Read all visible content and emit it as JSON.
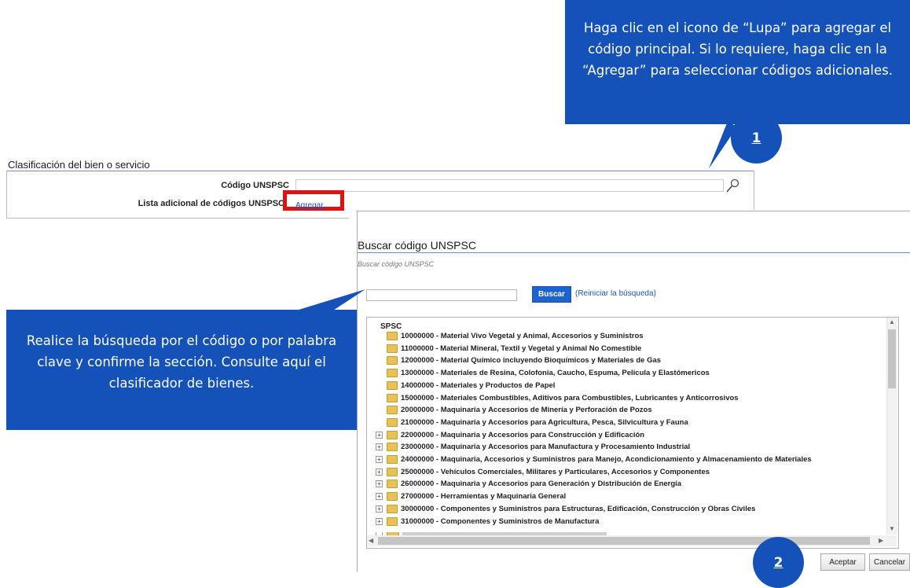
{
  "callout_1": {
    "text": "Haga clic en el icono de “Lupa” para agregar el código principal. Si lo requiere, haga clic en la “Agregar” para seleccionar códigos adicionales.",
    "step": "1"
  },
  "callout_2": {
    "text": "Realice la búsqueda por el código o por palabra clave y confirme la sección. Consulte aquí el clasificador de bienes."
  },
  "step_2": "2",
  "classification": {
    "title": "Clasificación del bien o servicio",
    "code_label": "Código UNSPSC",
    "code_value": "",
    "additional_label": "Lista adicional de códigos UNSPSC",
    "add_link": "Agregar."
  },
  "dialog": {
    "title": "Buscar código UNSPSC",
    "subtitle": "Buscar código UNSPSC",
    "search_value": "",
    "search_button": "Buscar",
    "reset_link": "(Reiniciar la búsqueda)",
    "tree_root": "SPSC",
    "accept_button": "Aceptar",
    "cancel_button": "Cancelar",
    "items": [
      {
        "label": "10000000 - Material Vivo Vegetal y Animal, Accesorios y Suministros",
        "expander": false
      },
      {
        "label": "11000000 - Material Mineral, Textil y Vegetal y Animal No Comestible",
        "expander": false
      },
      {
        "label": "12000000 - Material Químico incluyendo Bioquímicos y Materiales de Gas",
        "expander": false
      },
      {
        "label": "13000000 - Materiales de Resina, Colofonia, Caucho, Espuma, Película y Elastómericos",
        "expander": false
      },
      {
        "label": "14000000 - Materiales y Productos de Papel",
        "expander": false
      },
      {
        "label": "15000000 - Materiales Combustibles, Aditivos para Combustibles, Lubricantes y Anticorrosivos",
        "expander": false
      },
      {
        "label": "20000000 - Maquinaria y Accesorios de Minería y Perforación de Pozos",
        "expander": false
      },
      {
        "label": "21000000 - Maquinaria y Accesorios para Agricultura, Pesca, Silvicultura y Fauna",
        "expander": false
      },
      {
        "label": "22000000 - Maquinaria y Accesorios para Construcción y Edificación",
        "expander": true
      },
      {
        "label": "23000000 - Maquinaria y Accesorios para Manufactura y Procesamiento Industrial",
        "expander": true
      },
      {
        "label": "24000000 - Maquinaria, Accesorios y Suministros para Manejo, Acondicionamiento y Almacenamiento de Materiales",
        "expander": true
      },
      {
        "label": "25000000 - Vehículos Comerciales, Militares y Particulares, Accesorios y Componentes",
        "expander": true
      },
      {
        "label": "26000000 - Maquinaria y Accesorios para Generación y Distribución de Energía",
        "expander": true
      },
      {
        "label": "27000000 - Herramientas y Maquinaria General",
        "expander": true
      },
      {
        "label": "30000000 - Componentes y Suministros para Estructuras, Edificación, Construcción y Obras Civiles",
        "expander": true
      },
      {
        "label": "31000000 - Componentes y Suministros de Manufactura",
        "expander": true
      }
    ]
  },
  "colors": {
    "callout": "#1451b8",
    "highlight": "#e0110e",
    "link": "#1a55c9",
    "button": "#1b63d1"
  }
}
